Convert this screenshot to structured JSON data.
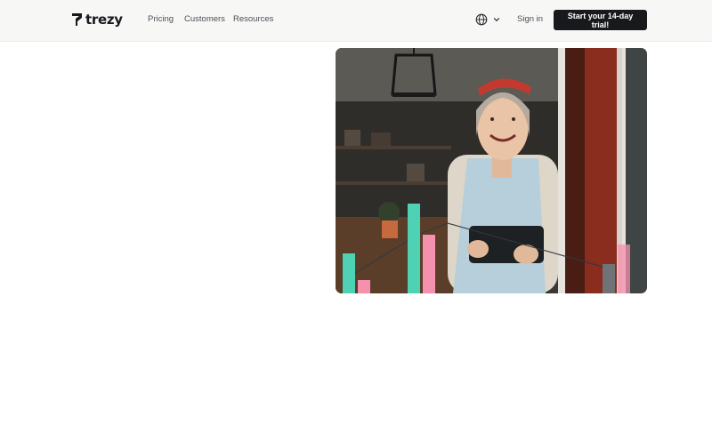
{
  "brand": {
    "name": "trezy"
  },
  "nav": {
    "items": [
      {
        "label": "Pricing"
      },
      {
        "label": "Customers"
      },
      {
        "label": "Resources"
      }
    ]
  },
  "header": {
    "language_icon": "globe-icon",
    "language_chevron": "chevron-down-icon",
    "signin_label": "Sign in",
    "cta_label": "Start your 14-day trial!"
  },
  "colors": {
    "accent_teal": "#4fd1b3",
    "accent_pink": "#f590ae",
    "cta_background": "#17191c",
    "header_background": "#f7f7f5"
  },
  "hero": {
    "image_subject": "shop owner in apron holding a tablet",
    "overlay": "decorative bar chart"
  }
}
